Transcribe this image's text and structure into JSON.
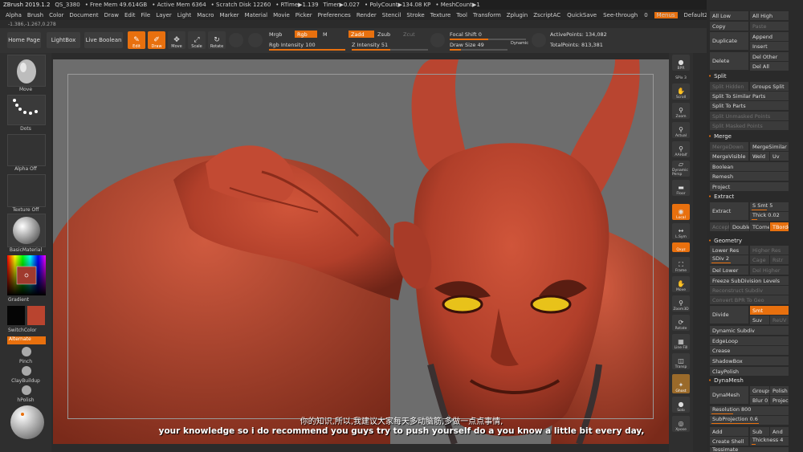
{
  "titlebar": {
    "app": "ZBrush 2019.1.2",
    "doc": "QS_3380",
    "free_mem": "• Free Mem 49.614GB",
    "active_mem": "• Active Mem 6364",
    "scratch": "• Scratch Disk 12260",
    "rtime": "• RTime▶1.139",
    "timer": "Timer▶0.027",
    "polycount": "• PolyCount▶134.08 KP",
    "meshcount": "• MeshCount▶1"
  },
  "menu": {
    "items": [
      "Alpha",
      "Brush",
      "Color",
      "Document",
      "Draw",
      "Edit",
      "File",
      "Layer",
      "Light",
      "Macro",
      "Marker",
      "Material",
      "Movie",
      "Picker",
      "Preferences",
      "Render",
      "Stencil",
      "Stroke",
      "Texture",
      "Tool",
      "Transform",
      "Zplugin",
      "Zscript"
    ],
    "ac": "AC",
    "quicksave": "QuickSave",
    "seethrough": "See-through",
    "seethrough_value": "0",
    "menus": "Menus",
    "script": "DefaultZScript"
  },
  "coords": "-1.386,-1.267,0.278",
  "shelf": {
    "home": "Home Page",
    "lightbox": "LightBox",
    "liveboolean": "Live Boolean",
    "edit": "Edit",
    "draw": "Draw",
    "move": "Move",
    "scale": "Scale",
    "rotate": "Rotate",
    "mrgb": "Mrgb",
    "rgb": "Rgb",
    "m": "M",
    "rgb_intensity": "Rgb Intensity 100",
    "zadd": "Zadd",
    "zsub": "Zsub",
    "zcut": "Zcut",
    "z_intensity": "Z Intensity 51",
    "focal_shift": "Focal Shift 0",
    "draw_size": "Draw Size 49",
    "dynamic": "Dynamic",
    "active_points": "ActivePoints: 134,082",
    "total_points": "TotalPoints: 813,381"
  },
  "left_tray": {
    "move": "Move",
    "dots": "Dots",
    "alpha_off": "Alpha Off",
    "texture_off": "Texture Off",
    "material": "BasicMaterial",
    "gradient": "Gradient",
    "switchcolor": "SwitchColor",
    "alternate": "Alternate",
    "pinch": "Pinch",
    "claybuildup": "ClayBuildup",
    "hpolish": "hPolish"
  },
  "right_shelf": [
    "BPR",
    "SPix 3",
    "Scroll",
    "Zoom",
    "Actual",
    "AAHalf",
    "Dynamic Persp",
    "Floor",
    "Local",
    "L.Sym",
    "Qxyz",
    "Frame",
    "Move",
    "Zoom3D",
    "Rotate",
    "Line Fill",
    "Transp",
    "Ghost",
    "Solo",
    "Xpose"
  ],
  "palette": {
    "all_low": "All Low",
    "all_high": "All High",
    "copy": "Copy",
    "paste": "Paste",
    "duplicate": "Duplicate",
    "append": "Append",
    "insert": "Insert",
    "delete": "Delete",
    "del_other": "Del Other",
    "del_all": "Del All",
    "split_head": "Split",
    "split_hidden": "Split Hidden",
    "groups_split": "Groups Split",
    "split_similar": "Split To Similar Parts",
    "split_parts": "Split To Parts",
    "split_unmasked": "Split Unmasked Points",
    "split_masked": "Split Masked Points",
    "merge_head": "Merge",
    "merge_down": "MergeDown",
    "merge_similar": "MergeSimilar",
    "merge_visible": "MergeVisible",
    "weld": "Weld",
    "uv": "Uv",
    "boolean": "Boolean",
    "remesh": "Remesh",
    "project": "Project",
    "extract_head": "Extract",
    "extract": "Extract",
    "s_smt": "S Smt 5",
    "thick": "Thick 0.02",
    "accept": "Accept",
    "double": "Double",
    "tcorne": "TCorne",
    "tborde": "TBorde",
    "geometry_head": "Geometry",
    "lower_res": "Lower Res",
    "higher_res": "Higher Res",
    "sdiv": "SDiv 2",
    "cage": "Cage",
    "rstr": "Rstr",
    "del_lower": "Del Lower",
    "del_higher": "Del Higher",
    "freeze": "Freeze SubDivision Levels",
    "reconstruct": "Reconstruct Subdiv",
    "convert_bpr": "Convert BPR To Geo",
    "divide": "Divide",
    "smt": "Smt",
    "suv": "Suv",
    "reuv": "ReUV",
    "dynamic_subdiv": "Dynamic Subdiv",
    "edgeloop": "EdgeLoop",
    "crease": "Crease",
    "shadowbox": "ShadowBox",
    "claypolish": "ClayPolish",
    "dynamesh_head": "DynaMesh",
    "dynamesh": "DynaMesh",
    "groups": "Groups",
    "polish": "Polish",
    "blur": "Blur 0",
    "project2": "Project",
    "resolution": "Resolution 800",
    "subprojection": "SubProjection 0.6",
    "add": "Add",
    "sub": "Sub",
    "and": "And",
    "create_shell": "Create Shell",
    "thickness": "Thickness 4",
    "zremesher": "Tessimate"
  },
  "subtitles": {
    "cn": "你的知识,所以,我建议大家每天多动脑筋,多做一点点事情,",
    "en": "your knowledge so i do recommend you guys try to push yourself do a you know a little bit every day,"
  },
  "colors": {
    "accent": "#e8700e",
    "skin": "#b9442f",
    "eye": "#e8c21a",
    "canvas": "#6d6d6d"
  }
}
